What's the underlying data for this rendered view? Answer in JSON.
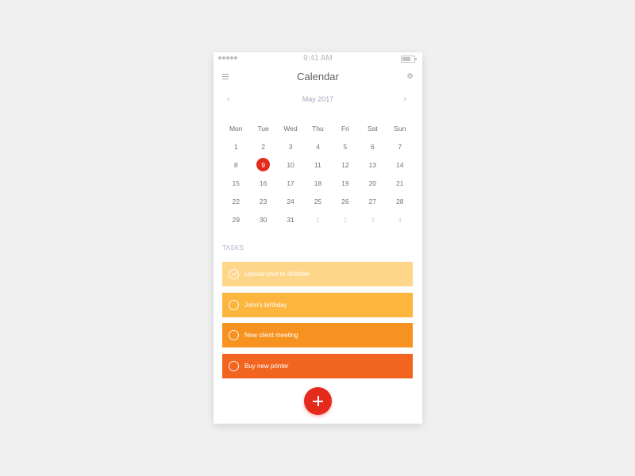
{
  "status_bar": {
    "time": "9:41 AM",
    "battery_level": 0.7
  },
  "header": {
    "title": "Calendar",
    "menu_icon": "hamburger-menu-icon",
    "settings_icon": "gear-icon"
  },
  "calendar": {
    "month_label": "May 2017",
    "prev_icon": "chevron-left-icon",
    "next_icon": "chevron-right-icon",
    "weekdays": [
      "Mon",
      "Tue",
      "Wed",
      "Thu",
      "Fri",
      "Sat",
      "Sun"
    ],
    "weeks": [
      [
        "1",
        "2",
        "3",
        "4",
        "5",
        "6",
        "7"
      ],
      [
        "8",
        "9",
        "10",
        "11",
        "12",
        "13",
        "14"
      ],
      [
        "15",
        "16",
        "17",
        "18",
        "19",
        "20",
        "21"
      ],
      [
        "22",
        "23",
        "24",
        "25",
        "26",
        "27",
        "28"
      ],
      [
        "29",
        "30",
        "31",
        "1",
        "2",
        "3",
        "4"
      ]
    ],
    "selected_day": "9",
    "selected_color": "#e42a1d",
    "next_month_days_in_last_week": 4
  },
  "tasks": {
    "label": "TASKS",
    "items": [
      {
        "text": "Upload shot to dribbble",
        "done": true,
        "color": "#fed68a"
      },
      {
        "text": "John's birthday",
        "done": false,
        "color": "#fcb53d"
      },
      {
        "text": "New client meeting",
        "done": false,
        "color": "#f6921f"
      },
      {
        "text": "Buy new printer",
        "done": false,
        "color": "#f16521"
      }
    ]
  },
  "fab": {
    "icon": "plus-icon",
    "color": "#e42a1d"
  }
}
